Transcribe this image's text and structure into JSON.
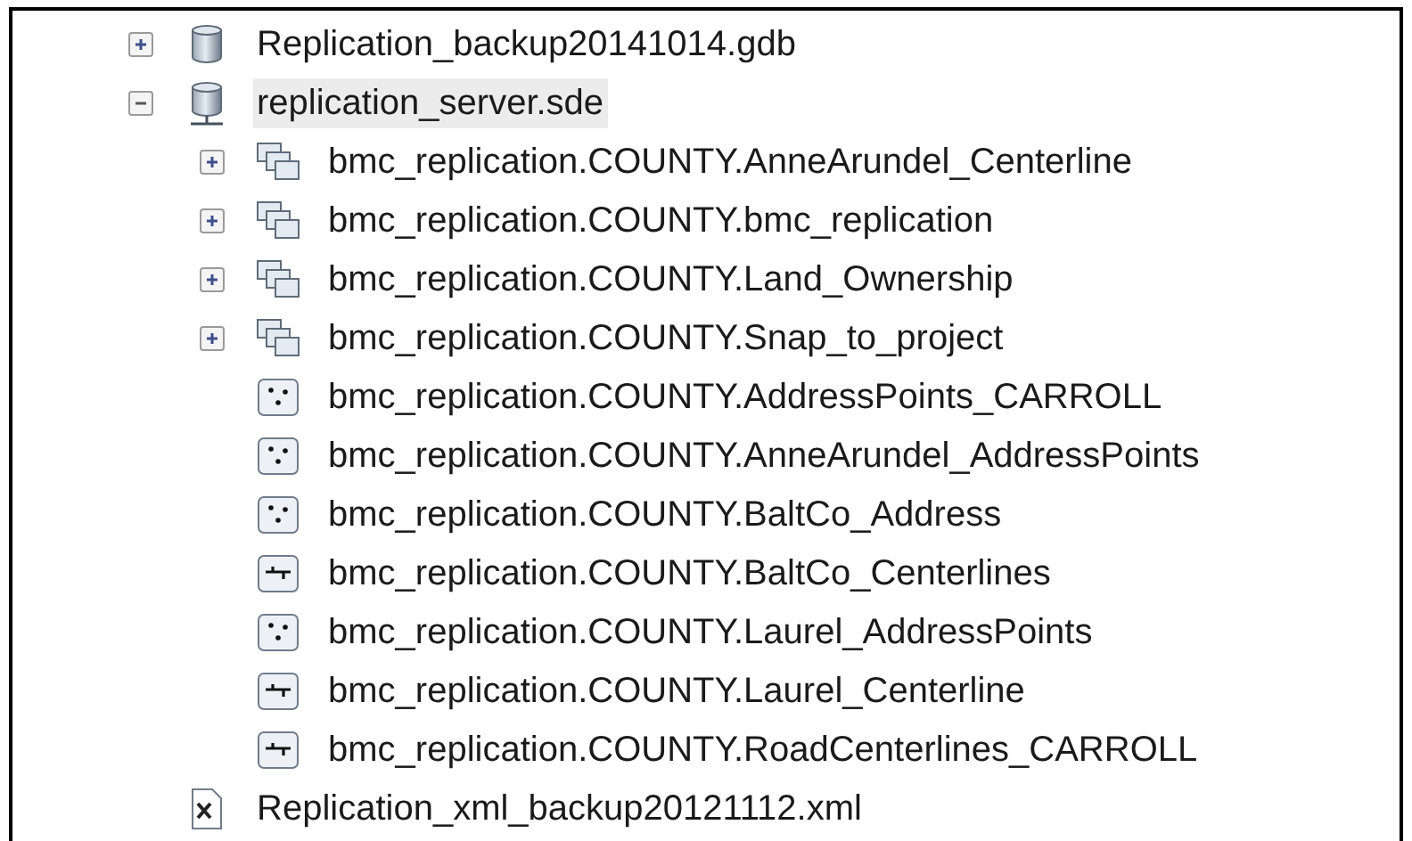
{
  "tree": [
    {
      "label": "Replication_backup20141014.gdb",
      "kind": "gdb",
      "expanded": false,
      "selected": false
    },
    {
      "label": "replication_server.sde",
      "kind": "sde",
      "expanded": true,
      "selected": true,
      "children": [
        {
          "label": "bmc_replication.COUNTY.AnneArundel_Centerline",
          "kind": "dataset",
          "expanded": false,
          "selected": false
        },
        {
          "label": "bmc_replication.COUNTY.bmc_replication",
          "kind": "dataset",
          "expanded": false,
          "selected": false
        },
        {
          "label": "bmc_replication.COUNTY.Land_Ownership",
          "kind": "dataset",
          "expanded": false,
          "selected": false
        },
        {
          "label": "bmc_replication.COUNTY.Snap_to_project",
          "kind": "dataset",
          "expanded": false,
          "selected": false
        },
        {
          "label": "bmc_replication.COUNTY.AddressPoints_CARROLL",
          "kind": "points",
          "selected": false
        },
        {
          "label": "bmc_replication.COUNTY.AnneArundel_AddressPoints",
          "kind": "points",
          "selected": false
        },
        {
          "label": "bmc_replication.COUNTY.BaltCo_Address",
          "kind": "points",
          "selected": false
        },
        {
          "label": "bmc_replication.COUNTY.BaltCo_Centerlines",
          "kind": "lines",
          "selected": false
        },
        {
          "label": "bmc_replication.COUNTY.Laurel_AddressPoints",
          "kind": "points",
          "selected": false
        },
        {
          "label": "bmc_replication.COUNTY.Laurel_Centerline",
          "kind": "lines",
          "selected": false
        },
        {
          "label": "bmc_replication.COUNTY.RoadCenterlines_CARROLL",
          "kind": "lines",
          "selected": false
        }
      ]
    },
    {
      "label": "Replication_xml_backup20121112.xml",
      "kind": "xml",
      "selected": false
    }
  ]
}
